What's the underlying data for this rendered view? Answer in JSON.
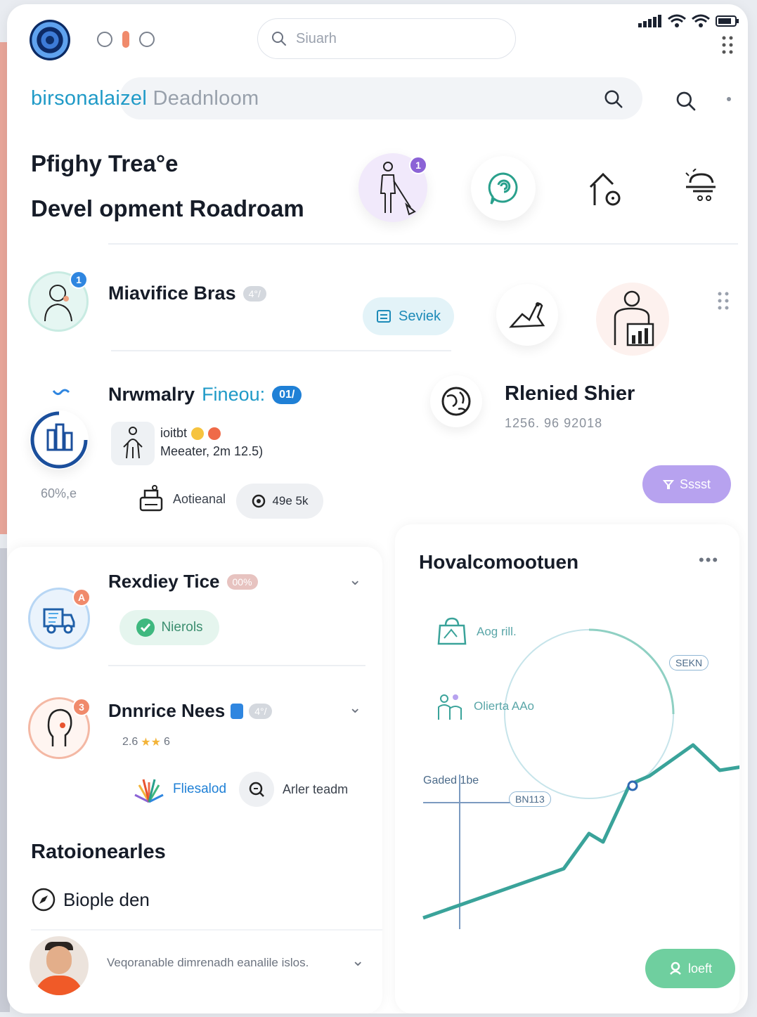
{
  "top": {
    "search_placeholder": "Siuarh"
  },
  "header": {
    "brand_primary": "birsonalaizel",
    "brand_secondary": "Deadnloom"
  },
  "hero": {
    "title_line1": "Pfighy Trea°e",
    "title_line2": "Devel opment Roadroam",
    "badge_count": "1"
  },
  "row1": {
    "title": "Miavifice Bras",
    "chip": "4°/",
    "button_label": "Seviek",
    "avatar_badge": "1"
  },
  "row2": {
    "title_prefix": "Nrwmalry",
    "title_accent": "Fineou:",
    "chip": "01/",
    "sub_line1": "ioitbt",
    "sub_line2": "Meeater, 2m 12.5)",
    "progress_text": "60%,e",
    "action_label": "Aotieanal",
    "pill_label": "49e 5k",
    "right_title": "Rlenied Shier",
    "right_value": "1256. 96 92018",
    "button_label": "Sssst"
  },
  "left_card": {
    "item1_title": "Rexdiey Tice",
    "item1_chip": "00%",
    "item1_badge": "A",
    "item1_pill": "Nierols",
    "item2_title": "Dnnrice Nees",
    "item2_chip": "4°/",
    "item2_badge": "3",
    "item2_rating_left": "2.6",
    "item2_rating_stars": "★★",
    "item2_rating_right": "6",
    "item2_link": "Fliesalod",
    "item2_action": "Arler teadm",
    "section_title": "Ratoionearles",
    "section_item": "Biople den",
    "footer_text": "Veqoranable dimrenadh eanalile islos."
  },
  "right_card": {
    "title": "Hovalcomootuen",
    "label1": "Aog rill.",
    "label2": "Olierta AAo",
    "axis_label": "Gaded 1be",
    "tag1": "SEKN",
    "tag2": "BN113",
    "fab_label": "loeft"
  },
  "colors": {
    "brand_teal": "#1f9ac7",
    "accent_purple": "#b7a2ef",
    "accent_green": "#6fcf9f",
    "badge_blue": "#2f86e0",
    "badge_orange": "#f08a6b",
    "chart_line": "#3aa39a"
  },
  "icons": [
    "logo-icon",
    "search-icon",
    "signal-icon",
    "wifi-icon",
    "battery-icon",
    "grid-dots-icon",
    "person-cleaning-icon",
    "chat-icon",
    "home-pin-icon",
    "weather-icon",
    "user-avatar-icon",
    "list-icon",
    "hand-icon",
    "worker-chart-icon",
    "building-icon",
    "globe-icon",
    "printer-icon",
    "target-icon",
    "filter-icon",
    "truck-icon",
    "check-icon",
    "face-icon",
    "star-icon",
    "sparkle-icon",
    "compass-icon",
    "profile-photo",
    "bag-icon",
    "people-icon",
    "chevron-down-icon"
  ]
}
